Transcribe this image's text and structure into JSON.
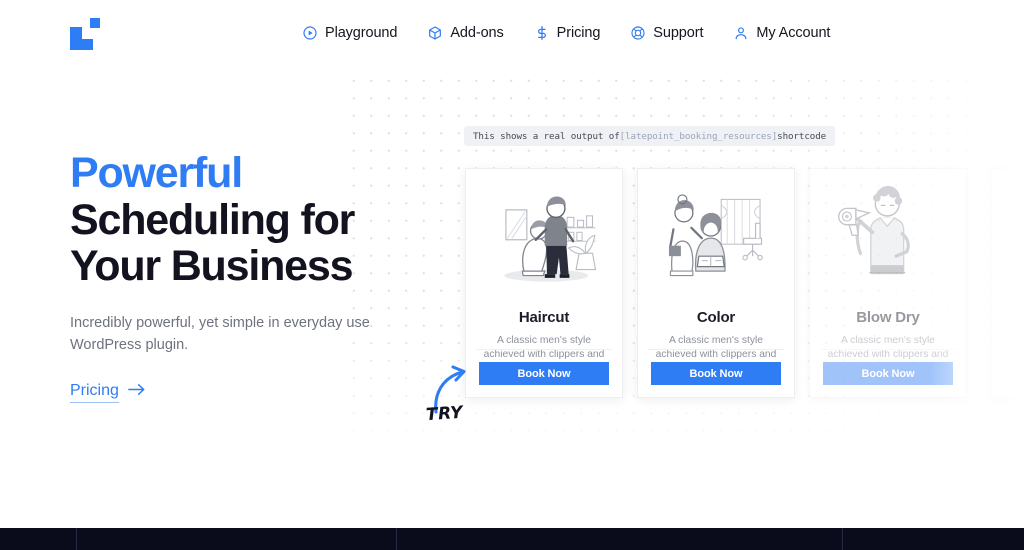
{
  "header": {
    "logo_name": "latepoint-logo",
    "nav": [
      {
        "label": "Playground",
        "icon": "play-circle-icon"
      },
      {
        "label": "Add-ons",
        "icon": "cube-icon"
      },
      {
        "label": "Pricing",
        "icon": "dollar-icon"
      },
      {
        "label": "Support",
        "icon": "lifebuoy-icon"
      },
      {
        "label": "My Account",
        "icon": "user-icon"
      }
    ]
  },
  "hero": {
    "title_accent": "Powerful",
    "title_line2": "Scheduling for",
    "title_line3": "Your Business",
    "subtitle": "Incredibly powerful, yet simple in everyday use WordPress plugin.",
    "cta_label": "Pricing",
    "cta_icon": "arrow-right-icon"
  },
  "shortcode_banner": {
    "prefix": "This shows a real output of ",
    "code": "[latepoint_booking_resources]",
    "suffix": " shortcode"
  },
  "cards": [
    {
      "title": "Haircut",
      "description": "A classic men's style achieved with clippers and scissors.",
      "button_label": "Book Now",
      "illustration": "barber-cutting-hair-illustration",
      "faded": false
    },
    {
      "title": "Color",
      "description": "A classic men's style achieved with clippers and scissors.",
      "button_label": "Book Now",
      "illustration": "hair-coloring-salon-illustration",
      "faded": false
    },
    {
      "title": "Blow Dry",
      "description": "A classic men's style achieved with clippers and scissors.",
      "button_label": "Book Now",
      "illustration": "person-with-hairdryer-illustration",
      "faded": true
    }
  ],
  "annotation": {
    "label": "TRY",
    "icon": "curved-arrow-icon"
  },
  "colors": {
    "accent_blue": "#2f7df4",
    "heading_dark": "#12131f",
    "body_gray": "#6e727e",
    "banner_bg": "#f0f1f4",
    "footer_dark": "#0b0c1b"
  }
}
